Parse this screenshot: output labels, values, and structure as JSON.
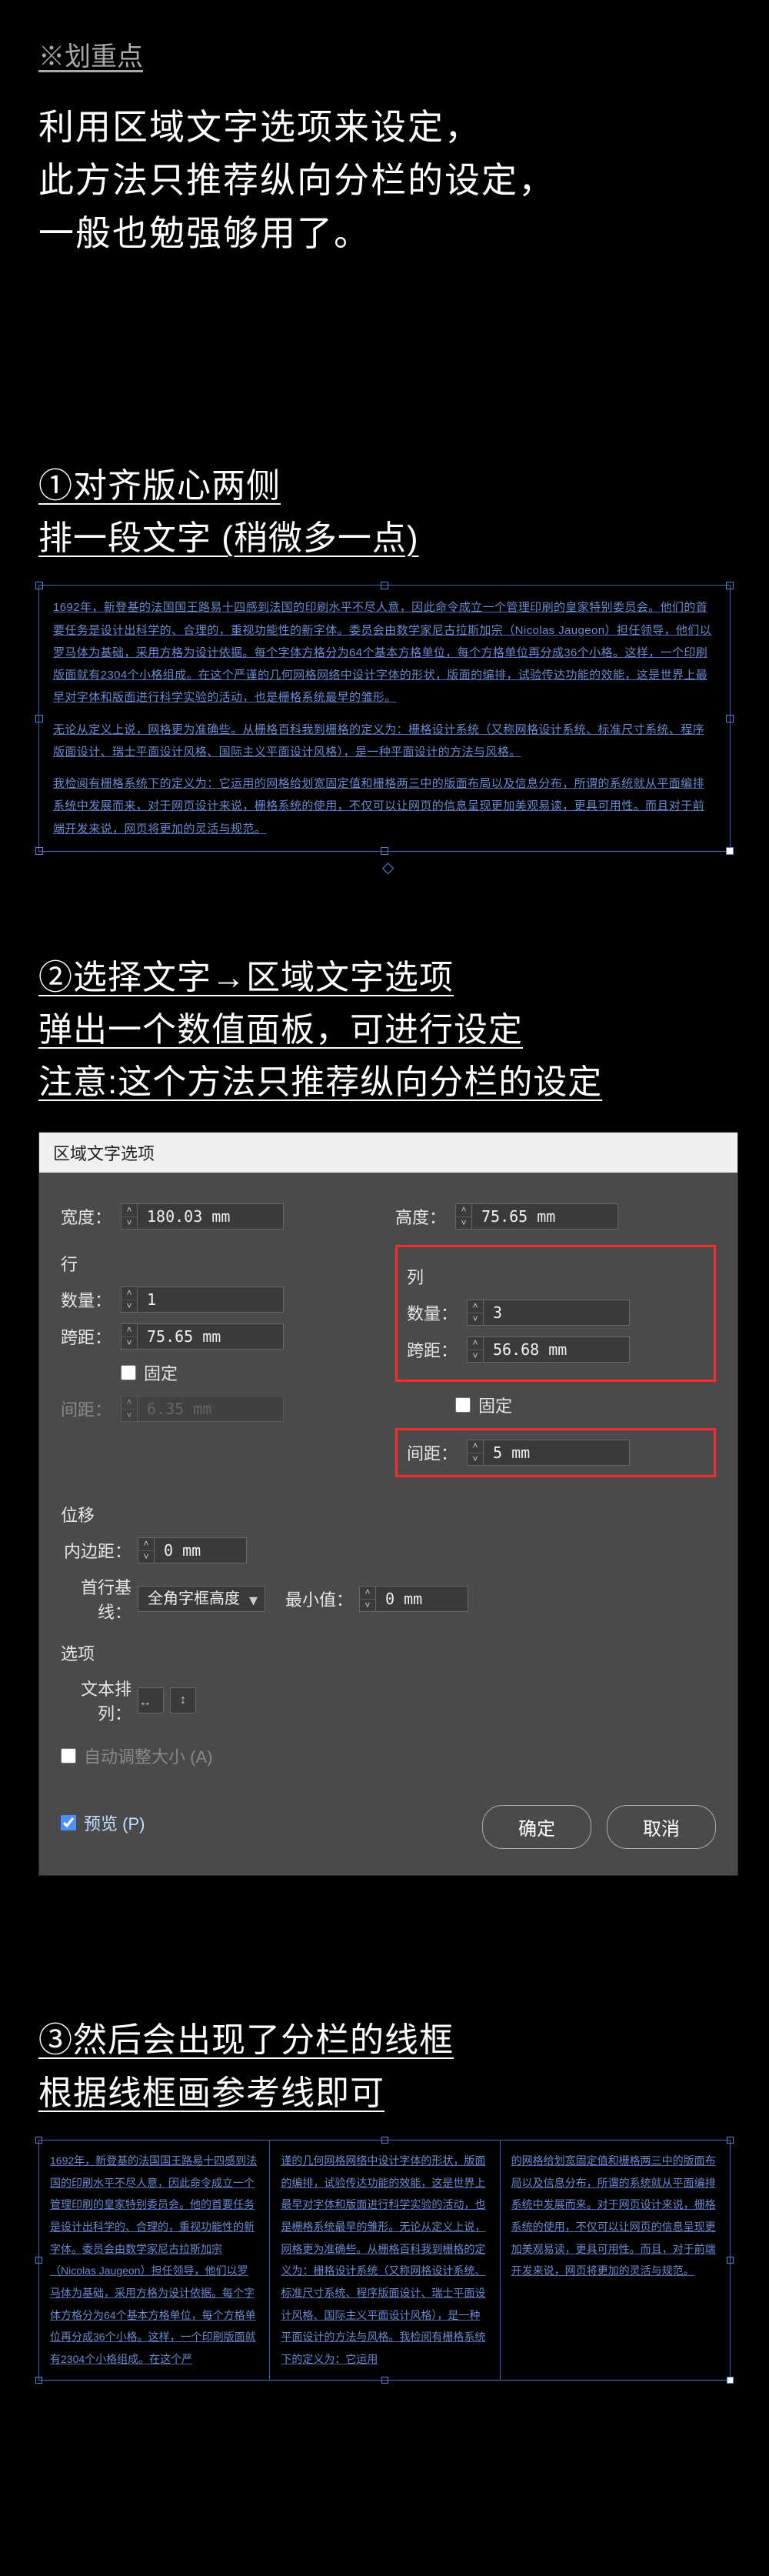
{
  "key_point": "※划重点",
  "intro": "利用区域文字选项来设定，\n此方法只推荐纵向分栏的设定，\n一般也勉强够用了。",
  "step1": {
    "heading": "①对齐版心两侧\n排一段文字 (稍微多一点)",
    "paras": [
      "1692年，新登基的法国国王路易十四感到法国的印刷水平不尽人意，因此命令成立一个管理印刷的皇家特别委员会。他们的首要任务是设计出科学的、合理的，重视功能性的新字体。委员会由数学家尼古拉斯加宗（Nicolas Jaugeon）担任领导，他们以罗马体为基础，采用方格为设计依据。每个字体方格分为64个基本方格单位，每个方格单位再分成36个小格。这样，一个印刷版面就有2304个小格组成。在这个严谨的几何网格网络中设计字体的形状，版面的编排，试验传达功能的效能，这是世界上最早对字体和版面进行科学实验的活动，也是栅格系统最早的雏形。",
      "无论从定义上说，网格更为准确些。从栅格百科我到栅格的定义为：栅格设计系统（又称网格设计系统、标准尺寸系统、程序版面设计、瑞士平面设计风格、国际主义平面设计风格），是一种平面设计的方法与风格。",
      "我检阅有栅格系统下的定义为：它运用的网格给划宽固定值和栅格两三中的版面布局以及信息分布，所谓的系统就从平面编排系统中发展而来，对于网页设计来说，栅格系统的使用，不仅可以让网页的信息呈现更加美观易读，更具可用性。而且对于前端开发来说，网页将更加的灵活与规范。"
    ]
  },
  "step2": {
    "heading": "②选择文字→区域文字选项\n弹出一个数值面板，可进行设定\n注意:这个方法只推荐纵向分栏的设定"
  },
  "dialog": {
    "title": "区域文字选项",
    "width_label": "宽度：",
    "width_value": "180.03 mm",
    "height_label": "高度：",
    "height_value": "75.65 mm",
    "row_section": "行",
    "col_section": "列",
    "count_label": "数量：",
    "row_count": "1",
    "col_count": "3",
    "span_label": "跨距：",
    "row_span": "75.65 mm",
    "col_span": "56.68 mm",
    "fixed_label": "固定",
    "gap_label": "间距：",
    "row_gap": "6.35 mm",
    "col_gap": "5 mm",
    "offset_section": "位移",
    "inset_label": "内边距：",
    "inset_value": "0 mm",
    "baseline_label": "首行基线：",
    "baseline_value": "全角字框高度",
    "min_label": "最小值：",
    "min_value": "0 mm",
    "options_section": "选项",
    "flow_label": "文本排列：",
    "autosize": "自动调整大小 (A)",
    "preview": "预览 (P)",
    "ok": "确定",
    "cancel": "取消"
  },
  "step3": {
    "heading": "③然后会出现了分栏的线框\n根据线框画参考线即可",
    "cols": [
      "1692年，新登基的法国国王路易十四感到法国的印刷水平不尽人意，因此命令成立一个管理印刷的皇家特别委员会。他的首要任务是设计出科学的、合理的，重视功能性的新字体。委员会由数学家尼古拉斯加宗（Nicolas Jaugeon）担任领导，他们以罗马体为基础，采用方格为设计依据。每个字体方格分为64个基本方格单位，每个方格单位再分成36个小格。这样，一个印刷版面就有2304个小格组成。在这个严",
      "谨的几何网格网络中设计字体的形状，版面的编排，试验传达功能的效能，这是世界上最早对字体和版面进行科学实验的活动，也是栅格系统最早的雏形。无论从定义上说，网格更为准确些。从栅格百科我到栅格的定义为：栅格设计系统（又称网格设计系统、标准尺寸系统、程序版面设计、瑞士平面设计风格、国际主义平面设计风格），是一种平面设计的方法与风格。我检阅有栅格系统下的定义为：它运用",
      "的网格给划宽固定值和栅格两三中的版面布局以及信息分布，所谓的系统就从平面编排系统中发展而来。对于网页设计来说，栅格系统的使用，不仅可以让网页的信息呈现更加美观易读，更具可用性。而且，对于前端开发来说，网页将更加的灵活与规范。"
    ]
  }
}
